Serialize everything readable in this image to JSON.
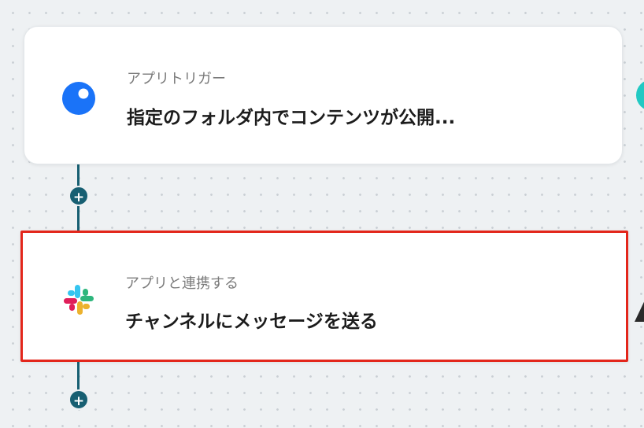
{
  "steps": [
    {
      "subtitle": "アプリトリガー",
      "title": "指定のフォルダ内でコンテンツが公開...",
      "icon": "blue-circle-app-icon"
    },
    {
      "subtitle": "アプリと連携する",
      "title": "チャンネルにメッセージを送る",
      "icon": "slack-icon",
      "selected": true
    }
  ],
  "add_step_label": "+",
  "colors": {
    "connector": "#175f72",
    "selection": "#e3261b",
    "trigger_icon": "#1a73f8"
  }
}
